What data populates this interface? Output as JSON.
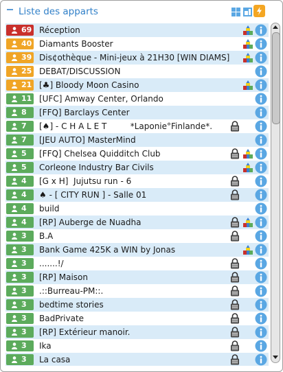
{
  "panel": {
    "title": "Liste des apparts",
    "icons": [
      "grid-icon",
      "layout-icon",
      "lightning-icon"
    ]
  },
  "colors": {
    "red": "#c9302c",
    "orange": "#f0a526",
    "green": "#5cab5c",
    "row_alt": "#d9ebf8",
    "title": "#2f7fc8",
    "info": "#5aa7e3"
  },
  "rooms": [
    {
      "count": "69",
      "color": "red",
      "name": "Réception",
      "lock": false,
      "group": true
    },
    {
      "count": "40",
      "color": "orange",
      "name": "Diamants Booster",
      "lock": false,
      "group": true
    },
    {
      "count": "39",
      "color": "orange",
      "name": "Dis¢othèque - Mini-jeux à 21H30 [WIN DIAMS]",
      "lock": false,
      "group": true
    },
    {
      "count": "25",
      "color": "orange",
      "name": "DEBAT/DISCUSSION",
      "lock": false,
      "group": false
    },
    {
      "count": "21",
      "color": "orange",
      "name": "[♣] Bloody Moon Casino",
      "lock": false,
      "group": true
    },
    {
      "count": "11",
      "color": "green",
      "name": "[UFC] Amway Center, Orlando",
      "lock": false,
      "group": false
    },
    {
      "count": "8",
      "color": "green",
      "name": "[FFQ] Barclays Center",
      "lock": false,
      "group": false
    },
    {
      "count": "7",
      "color": "green",
      "name": "[♠] - C H A L E T         *Laponie°Finlande*.",
      "lock": true,
      "group": false
    },
    {
      "count": "7",
      "color": "green",
      "name": "[JEU AUTO] MasterMind",
      "lock": false,
      "group": false
    },
    {
      "count": "5",
      "color": "green",
      "name": "[FFQ] Chelsea Quidditch Club",
      "lock": true,
      "group": true
    },
    {
      "count": "5",
      "color": "green",
      "name": "Corleone Industry Bar Civils",
      "lock": false,
      "group": true
    },
    {
      "count": "4",
      "color": "green",
      "name": "[G x H]  Jujutsu run - 6",
      "lock": true,
      "group": false
    },
    {
      "count": "4",
      "color": "green",
      "name": "♠ - [ CITY RUN ] - Salle 01",
      "lock": true,
      "group": false
    },
    {
      "count": "4",
      "color": "green",
      "name": "build",
      "lock": false,
      "group": false
    },
    {
      "count": "4",
      "color": "green",
      "name": "[RP] Auberge de Nuadha",
      "lock": true,
      "group": true
    },
    {
      "count": "3",
      "color": "green",
      "name": "B.A",
      "lock": true,
      "group": false
    },
    {
      "count": "3",
      "color": "green",
      "name": "Bank Game 425K a WIN by Jonas",
      "lock": false,
      "group": true
    },
    {
      "count": "3",
      "color": "green",
      "name": ".......!/",
      "lock": true,
      "group": false
    },
    {
      "count": "3",
      "color": "green",
      "name": "[RP] Maison",
      "lock": true,
      "group": false
    },
    {
      "count": "3",
      "color": "green",
      "name": ".::Burreau-PM::.",
      "lock": true,
      "group": false
    },
    {
      "count": "3",
      "color": "green",
      "name": "bedtime stories",
      "lock": true,
      "group": false
    },
    {
      "count": "3",
      "color": "green",
      "name": "BadPrivate",
      "lock": true,
      "group": false
    },
    {
      "count": "3",
      "color": "green",
      "name": "[RP] Extérieur manoir.",
      "lock": true,
      "group": false
    },
    {
      "count": "3",
      "color": "green",
      "name": "Ika",
      "lock": true,
      "group": false
    },
    {
      "count": "3",
      "color": "green",
      "name": "La casa",
      "lock": true,
      "group": false
    }
  ]
}
